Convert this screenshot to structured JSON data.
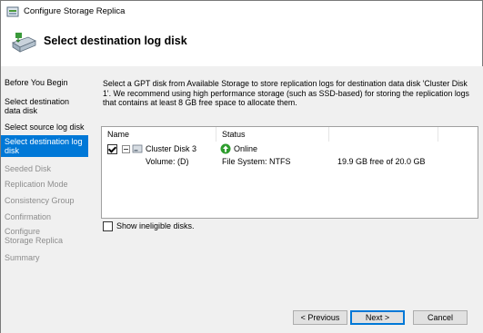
{
  "window": {
    "title": "Configure Storage Replica"
  },
  "header": {
    "title": "Select destination log disk"
  },
  "nav": {
    "items": [
      {
        "label": "Before You Begin",
        "state": "normal"
      },
      {
        "label": "Select destination data disk",
        "state": "normal"
      },
      {
        "label": "Select source log disk",
        "state": "normal"
      },
      {
        "label": "Select destination log disk",
        "state": "selected"
      },
      {
        "label": "Seeded Disk",
        "state": "disabled"
      },
      {
        "label": "Replication Mode",
        "state": "disabled"
      },
      {
        "label": "Consistency Group",
        "state": "disabled"
      },
      {
        "label": "Confirmation",
        "state": "disabled"
      },
      {
        "label": "Configure Storage Replica",
        "state": "disabled"
      },
      {
        "label": "Summary",
        "state": "disabled"
      }
    ]
  },
  "description": "Select a GPT disk from Available Storage to store replication logs for destination data disk 'Cluster Disk 1'. We recommend using high performance storage (such as SSD-based) for storing the replication logs that contains at least 8 GB free space to allocate them.",
  "list": {
    "columns": [
      "Name",
      "Status"
    ],
    "disk": {
      "name": "Cluster Disk 3",
      "checked": true,
      "status": "Online",
      "volume": "Volume: (D)",
      "filesystem": "File System: NTFS",
      "free": "19.9 GB free of 20.0 GB"
    }
  },
  "show_ineligible": {
    "label": "Show ineligible disks.",
    "checked": false
  },
  "buttons": {
    "previous": "< Previous",
    "next": "Next >",
    "cancel": "Cancel"
  },
  "colors": {
    "selection": "#0078d7",
    "status_green": "#2e9d2e",
    "panel_bg": "#f0f0f0"
  },
  "icons": {
    "app": "storage-replica-icon",
    "header": "storage-drive-icon",
    "disk": "disk-icon",
    "status": "online-arrow-icon"
  }
}
